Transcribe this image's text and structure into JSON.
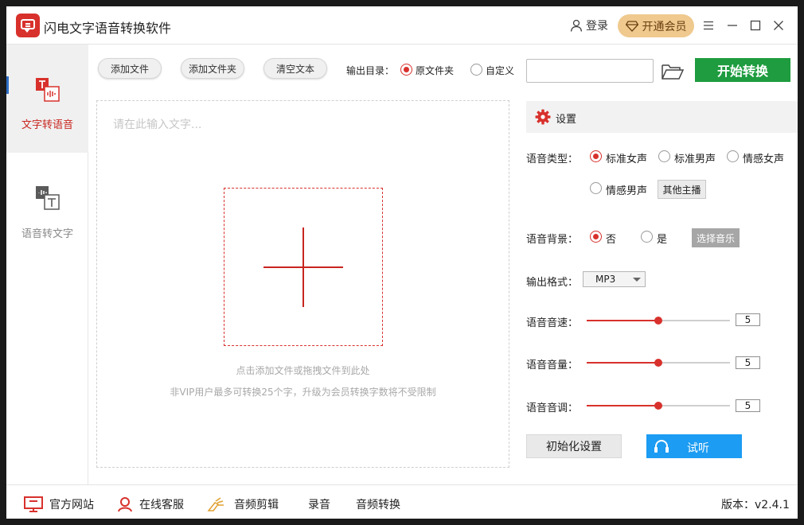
{
  "app": {
    "title": "闪电文字语音转换软件"
  },
  "header": {
    "login": "登录",
    "vip": "开通会员"
  },
  "sidebar": {
    "items": [
      {
        "label": "文字转语音",
        "active": true
      },
      {
        "label": "语音转文字",
        "active": false
      }
    ]
  },
  "toolbar": {
    "add_file": "添加文件",
    "add_folder": "添加文件夹",
    "clear_text": "清空文本",
    "output_dir_label": "输出目录：",
    "opt_source_folder": "原文件夹",
    "opt_custom": "自定义",
    "output_path_value": "",
    "start": "开始转换"
  },
  "editor": {
    "placeholder": "请在此输入文字...",
    "hint1": "点击添加文件或拖拽文件到此处",
    "hint2": "非VIP用户最多可转换25个字，升级为会员转换字数将不受限制"
  },
  "settings": {
    "title": "设置",
    "voice_type_label": "语音类型：",
    "voice_options": [
      "标准女声",
      "标准男声",
      "情感女声",
      "情感男声"
    ],
    "voice_selected": "标准女声",
    "other_anchor": "其他主播",
    "bg_label": "语音背景：",
    "bg_no": "否",
    "bg_yes": "是",
    "choose_music": "选择音乐",
    "format_label": "输出格式：",
    "format_value": "MP3",
    "speed_label": "语音音速：",
    "speed_value": "5",
    "volume_label": "语音音量：",
    "volume_value": "5",
    "pitch_label": "语音音调：",
    "pitch_value": "5",
    "slider_fraction": 0.5,
    "reset": "初始化设置",
    "listen": "试听"
  },
  "bottom": {
    "website": "官方网站",
    "service": "在线客服",
    "audio_edit": "音频剪辑",
    "record": "录音",
    "audio_convert": "音频转换",
    "version": "版本：v2.4.1"
  },
  "colors": {
    "accent": "#d8312c",
    "start_green": "#1e9c3f",
    "listen_blue": "#1c9cf2",
    "vip_gold": "#efc98e"
  }
}
